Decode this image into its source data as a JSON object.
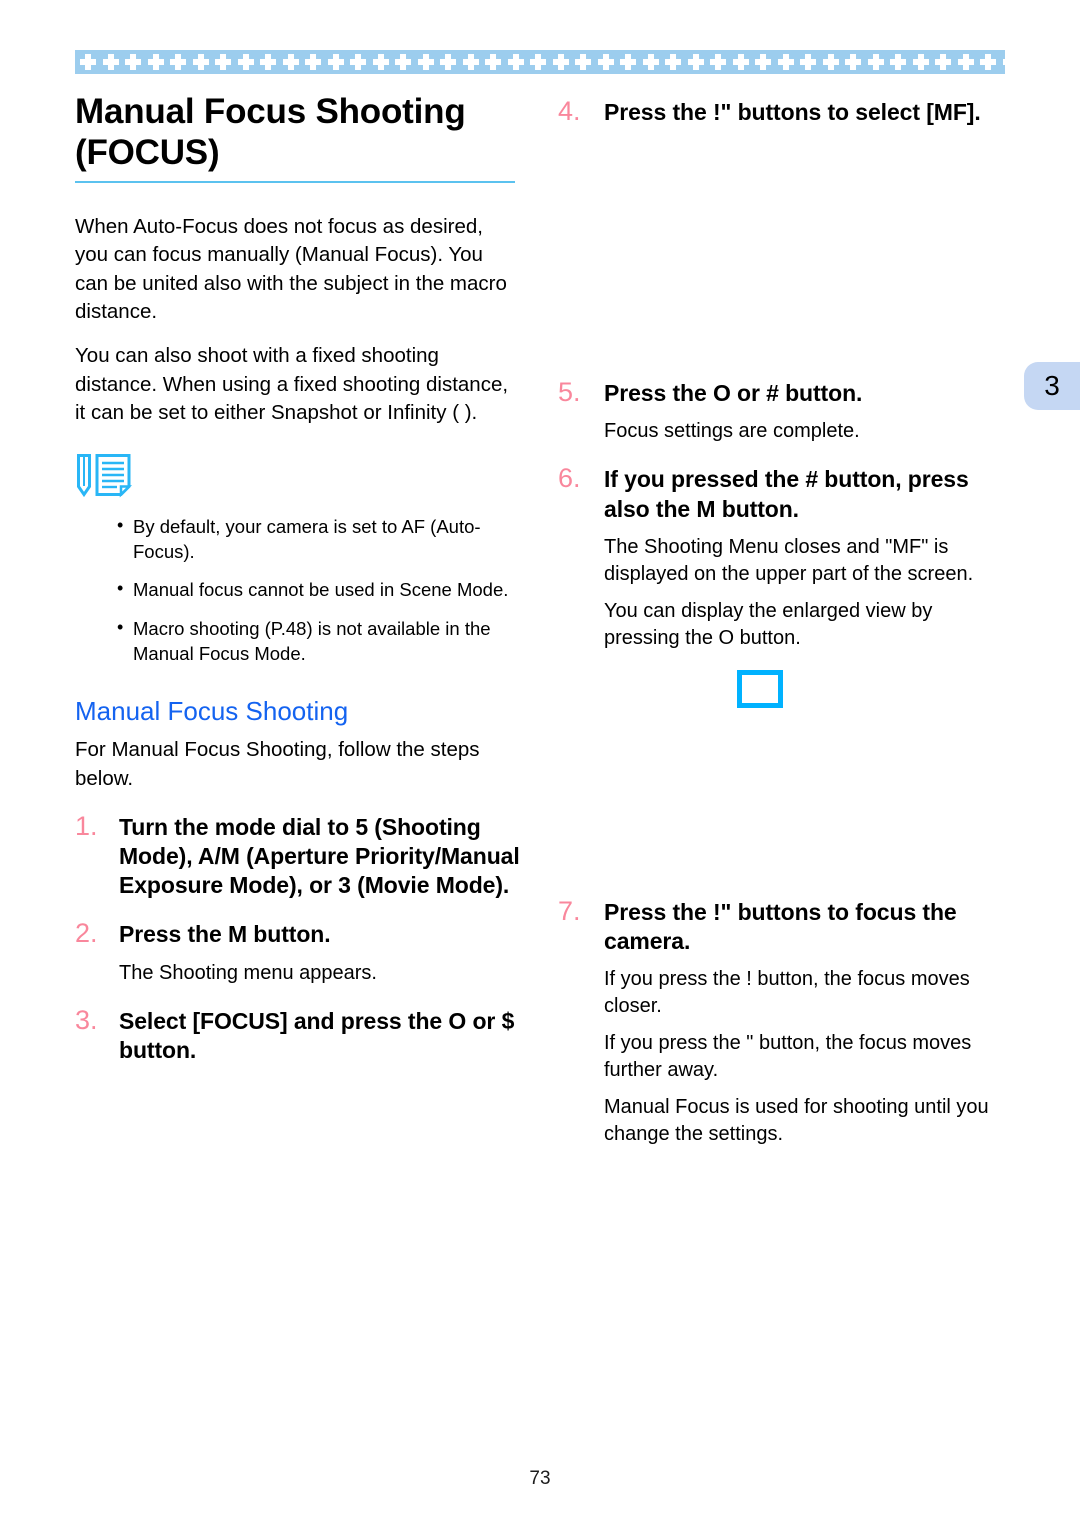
{
  "document": {
    "page_number": "73",
    "chapter_tab": "3",
    "colors": {
      "band": "#9ccdee",
      "rule": "#5bc2ef",
      "subheading": "#1463f0",
      "step_number": "#f9879c",
      "tab": "#c5d7f3",
      "placeholder_border": "#00b2ff",
      "memo_icon": "#29b6f6"
    }
  },
  "title": {
    "line1": "Manual Focus Shooting",
    "line2": "(FOCUS)"
  },
  "intro": {
    "paragraph1": "When Auto-Focus does not focus as desired, you can focus manually (Manual Focus). You can be united also with the subject in the macro distance.",
    "paragraph2": "You can also shoot with a fixed shooting distance. When using a fixed shooting distance, it can be set to either Snapshot or Infinity (  )."
  },
  "memo": {
    "icon_name": "memo-note-icon",
    "items": [
      "By default, your camera is set to AF (Auto-Focus).",
      "Manual focus cannot be used in Scene Mode.",
      "Macro shooting (P.48) is not available in the Manual Focus Mode."
    ]
  },
  "section": {
    "heading": "Manual Focus Shooting",
    "lead": "For Manual Focus Shooting, follow the steps below."
  },
  "steps": [
    {
      "num": "1.",
      "title": "Turn the mode dial to 5  (Shooting Mode), A/M (Aperture Priority/Manual Exposure Mode), or 3  (Movie Mode).",
      "descs": []
    },
    {
      "num": "2.",
      "title": "Press the M     button.",
      "descs": [
        "The Shooting menu appears."
      ]
    },
    {
      "num": "3.",
      "title": "Select  [FOCUS] and press the O   or $  button.",
      "descs": []
    },
    {
      "num": "4.",
      "title": "Press the !\"    buttons to select [MF].",
      "descs": []
    },
    {
      "num": "5.",
      "title": "Press the O   or #  button.",
      "descs": [
        "Focus settings are complete."
      ]
    },
    {
      "num": "6.",
      "title": "If you pressed the #  button, press also the M     button.",
      "descs": [
        "The Shooting Menu closes and \"MF\" is displayed on the upper part of the screen.",
        "You can display the enlarged view by pressing the O   button."
      ]
    },
    {
      "num": "7.",
      "title": "Press the !\"    buttons to focus the camera.",
      "descs": [
        "If you press the !   button, the focus moves closer.",
        "If you press the \"   button, the focus moves further away.",
        "Manual Focus is used for shooting until you change the settings."
      ]
    }
  ]
}
